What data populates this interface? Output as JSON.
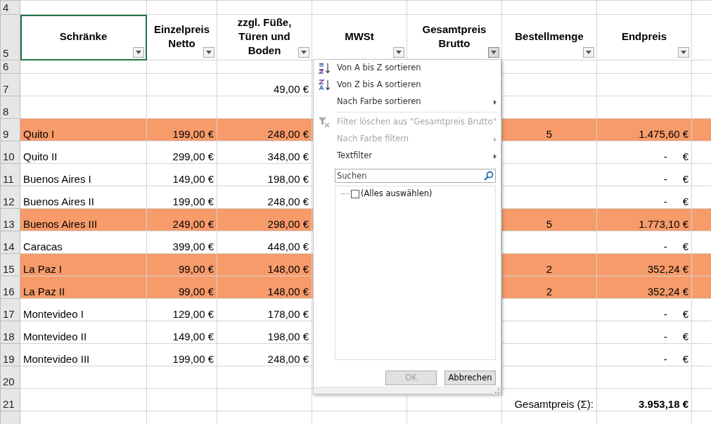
{
  "sheet": {
    "top_row": "4",
    "columns": [
      {
        "label": "Schränke",
        "filter_active": false
      },
      {
        "label": "Einzelpreis\nNetto",
        "filter_active": false
      },
      {
        "label": "zzgl. Füße,\nTüren und\nBoden",
        "filter_active": false
      },
      {
        "label": "MWSt",
        "filter_active": false
      },
      {
        "label": "Gesamtpreis\nBrutto",
        "filter_active": true
      },
      {
        "label": "Bestellmenge",
        "filter_active": false
      },
      {
        "label": "Endpreis",
        "filter_active": false
      }
    ],
    "header_row": "5",
    "rows": [
      {
        "num": "6",
        "highlight": false
      },
      {
        "num": "7",
        "gesamt": "49,00 €",
        "highlight": false
      },
      {
        "num": "8",
        "highlight": false
      },
      {
        "num": "9",
        "name": "Quito I",
        "netto": "199,00 €",
        "gesamt": "248,00 €",
        "menge": "5",
        "endpreis": {
          "amount": "1.475,60",
          "currency": "€",
          "kind": "value"
        },
        "highlight": true
      },
      {
        "num": "10",
        "name": "Quito II",
        "netto": "299,00 €",
        "gesamt": "348,00 €",
        "endpreis": {
          "amount": "-",
          "currency": "€",
          "kind": "zero"
        },
        "highlight": false
      },
      {
        "num": "11",
        "name": "Buenos Aires I",
        "netto": "149,00 €",
        "gesamt": "198,00 €",
        "endpreis": {
          "amount": "-",
          "currency": "€",
          "kind": "zero"
        },
        "highlight": false
      },
      {
        "num": "12",
        "name": "Buenos Aires II",
        "netto": "199,00 €",
        "gesamt": "248,00 €",
        "endpreis": {
          "amount": "-",
          "currency": "€",
          "kind": "zero"
        },
        "highlight": false
      },
      {
        "num": "13",
        "name": "Buenos Aires III",
        "netto": "249,00 €",
        "gesamt": "298,00 €",
        "menge": "5",
        "endpreis": {
          "amount": "1.773,10",
          "currency": "€",
          "kind": "value"
        },
        "highlight": true
      },
      {
        "num": "14",
        "name": "Caracas",
        "netto": "399,00 €",
        "gesamt": "448,00 €",
        "endpreis": {
          "amount": "-",
          "currency": "€",
          "kind": "zero"
        },
        "highlight": false
      },
      {
        "num": "15",
        "name": "La Paz I",
        "netto": "99,00 €",
        "gesamt": "148,00 €",
        "menge": "2",
        "endpreis": {
          "amount": "352,24",
          "currency": "€",
          "kind": "value"
        },
        "highlight": true
      },
      {
        "num": "16",
        "name": "La Paz II",
        "netto": "99,00 €",
        "gesamt": "148,00 €",
        "menge": "2",
        "endpreis": {
          "amount": "352,24",
          "currency": "€",
          "kind": "value"
        },
        "highlight": true
      },
      {
        "num": "17",
        "name": "Montevideo I",
        "netto": "129,00 €",
        "gesamt": "178,00 €",
        "endpreis": {
          "amount": "-",
          "currency": "€",
          "kind": "zero"
        },
        "highlight": false
      },
      {
        "num": "18",
        "name": "Montevideo II",
        "netto": "149,00 €",
        "gesamt": "198,00 €",
        "endpreis": {
          "amount": "-",
          "currency": "€",
          "kind": "zero"
        },
        "highlight": false
      },
      {
        "num": "19",
        "name": "Montevideo III",
        "netto": "199,00 €",
        "gesamt": "248,00 €",
        "endpreis": {
          "amount": "-",
          "currency": "€",
          "kind": "zero"
        },
        "highlight": false
      },
      {
        "num": "20",
        "highlight": false
      },
      {
        "num": "21",
        "total_label": "Gesamtpreis (Σ):",
        "total": "3.953,18 €",
        "highlight": false
      }
    ]
  },
  "filter_menu": {
    "items": [
      {
        "kind": "sort_az",
        "label": "Von A bis Z sortieren",
        "disabled": false
      },
      {
        "kind": "sort_za",
        "label": "Von Z bis A sortieren",
        "disabled": false
      },
      {
        "kind": "submenu",
        "label": "Nach Farbe sortieren",
        "disabled": false
      },
      {
        "kind": "separator"
      },
      {
        "kind": "clear_filter",
        "label": "Filter löschen aus \"Gesamtpreis Brutto\"",
        "disabled": true
      },
      {
        "kind": "submenu",
        "label": "Nach Farbe filtern",
        "disabled": true
      },
      {
        "kind": "submenu",
        "label": "Textfilter",
        "disabled": false
      }
    ],
    "search": {
      "placeholder": "Suchen"
    },
    "values": [
      {
        "label": "(Alles auswählen)",
        "checked": false
      }
    ],
    "buttons": [
      {
        "label": "OK",
        "disabled": true
      },
      {
        "label": "Abbrechen",
        "disabled": false
      }
    ]
  }
}
